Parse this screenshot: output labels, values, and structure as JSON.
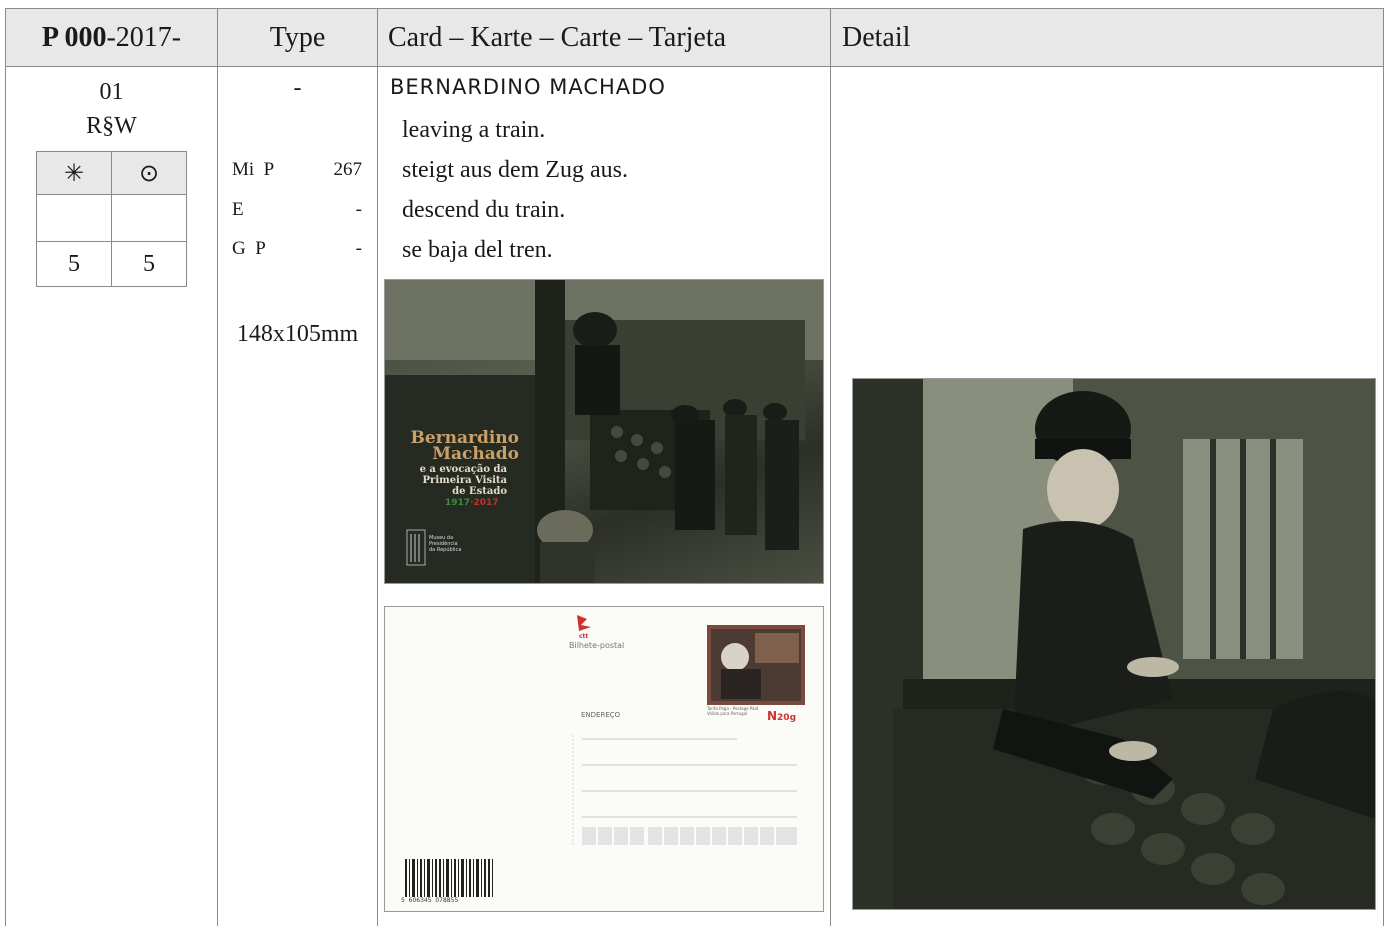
{
  "header": {
    "catalog_bold": "P 000",
    "catalog_rest": "-2017-",
    "type_label": "Type",
    "card_label": "Card – Karte – Carte – Tarjeta",
    "detail_label": "Detail"
  },
  "entry": {
    "number": "01",
    "code": "R§W",
    "price_symbols": [
      "✳",
      "⊙"
    ],
    "price_mid": [
      "",
      ""
    ],
    "price_values": [
      "5",
      "5"
    ],
    "type_dash": "-",
    "catalogs": [
      {
        "name": "Mi  P",
        "value": "267"
      },
      {
        "name": "E",
        "value": "-"
      },
      {
        "name": "G  P",
        "value": "-"
      }
    ],
    "size": "148x105mm",
    "subject": "BERNARDINO MACHADO",
    "descriptions": [
      "leaving a train.",
      "steigt aus dem Zug aus.",
      "descend du train.",
      "se baja del tren."
    ]
  },
  "front_card": {
    "title_1": "Bernardino",
    "title_2": "Machado",
    "subtitle": "e a evocação da",
    "subtitle_2": "Primeira Visita",
    "subtitle_3": "de Estado",
    "years_a": "1917",
    "years_b": "2017",
    "museum_1": "Museu da",
    "museum_2": "Presidência",
    "museum_3": "da República"
  },
  "back_card": {
    "brand": "ctt",
    "label": "Bilhete-postal",
    "address_label": "ENDEREÇO",
    "stamp_value_prefix": "N",
    "stamp_value": "20g",
    "stamp_caption_1": "Tarifa Paga - Postage Paid",
    "stamp_caption_2": "Válido para Portugal",
    "barcode_digits": "5  606345  078855"
  },
  "colors": {
    "header_bg": "#e8e8e8",
    "grid_line": "#8a8a8a",
    "stamp_red": "#d0312d",
    "front_title": "#c9a06a",
    "year_green": "#3d8a3c",
    "year_red": "#c9302c"
  }
}
